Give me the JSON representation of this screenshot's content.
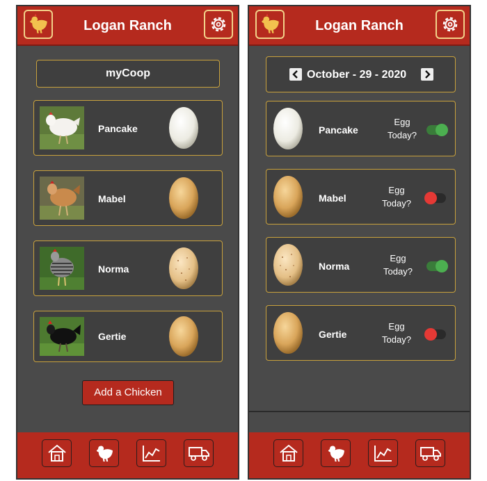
{
  "app": {
    "title": "Logan Ranch"
  },
  "coop": {
    "title": "myCoop",
    "add_button": "Add a Chicken",
    "chickens": [
      {
        "name": "Pancake",
        "egg_color": "white"
      },
      {
        "name": "Mabel",
        "egg_color": "tan"
      },
      {
        "name": "Norma",
        "egg_color": "speckled"
      },
      {
        "name": "Gertie",
        "egg_color": "tan"
      }
    ]
  },
  "log": {
    "date": "October - 29 - 2020",
    "question": "Egg Today?",
    "entries": [
      {
        "name": "Pancake",
        "egg_today": true
      },
      {
        "name": "Mabel",
        "egg_today": false
      },
      {
        "name": "Norma",
        "egg_today": true
      },
      {
        "name": "Gertie",
        "egg_today": false
      }
    ]
  },
  "nav": [
    "home-icon",
    "chicken-icon",
    "chart-icon",
    "truck-icon"
  ],
  "colors": {
    "brand": "#b52a1e",
    "background": "#4a4a4a",
    "card_border": "#c9a23d",
    "toggle_on": "#4caf50",
    "toggle_off": "#e53935"
  }
}
